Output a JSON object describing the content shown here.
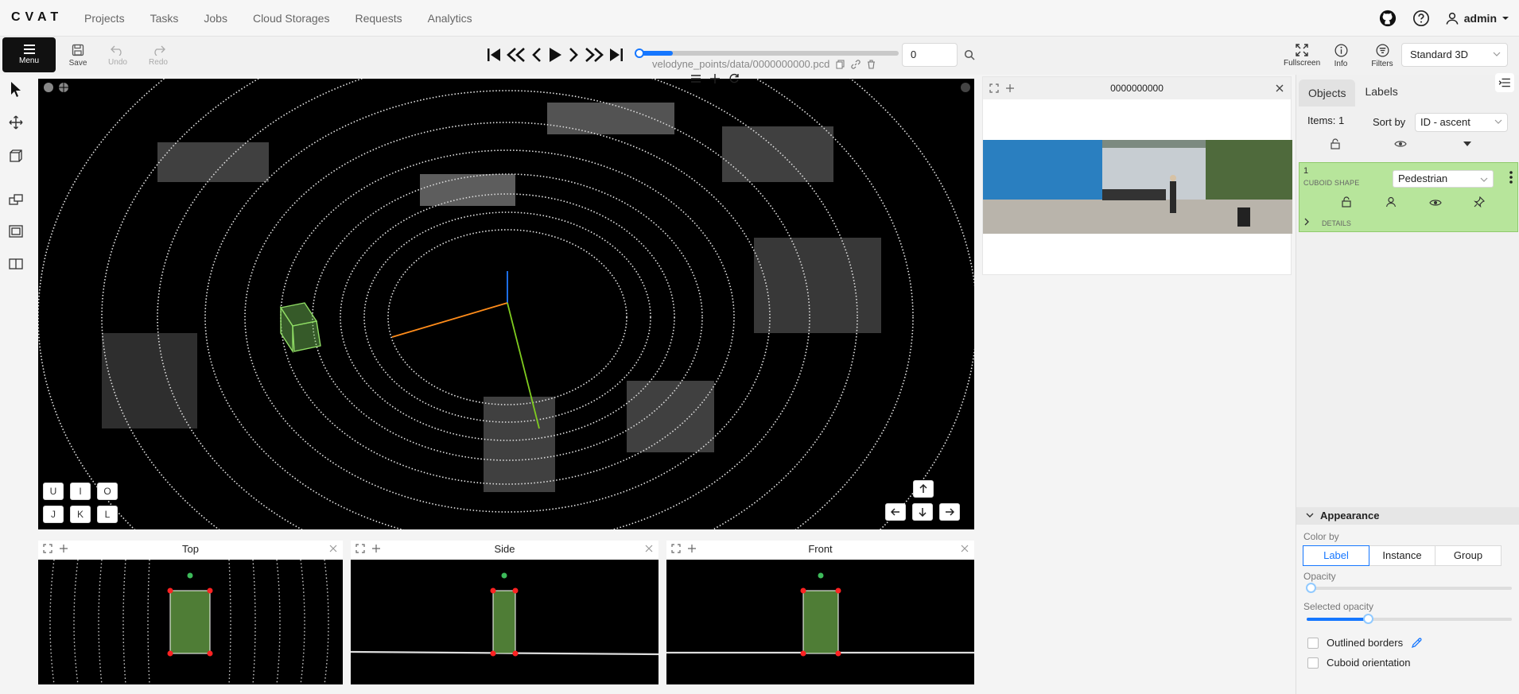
{
  "app": {
    "logo": "CVAT"
  },
  "nav": {
    "items": [
      "Projects",
      "Tasks",
      "Jobs",
      "Cloud Storages",
      "Requests",
      "Analytics"
    ]
  },
  "user": {
    "name": "admin"
  },
  "toolbar": {
    "menu_label": "Menu",
    "save_label": "Save",
    "undo_label": "Undo",
    "redo_label": "Redo",
    "frame_value": "0",
    "filename": "velodyne_points/data/0000000000.pcd",
    "progress": 0.14,
    "fullscreen_label": "Fullscreen",
    "info_label": "Info",
    "filters_label": "Filters",
    "workspace": "Standard 3D"
  },
  "views": {
    "top": "Top",
    "side": "Side",
    "front": "Front",
    "keys_row1": [
      "U",
      "I",
      "O"
    ],
    "keys_row2": [
      "J",
      "K",
      "L"
    ]
  },
  "image_panel": {
    "title": "0000000000"
  },
  "sidebar": {
    "tabs": [
      "Objects",
      "Labels"
    ],
    "items_count": "Items: 1",
    "sort_label": "Sort by",
    "sort_value": "ID - ascent",
    "object": {
      "id": "1",
      "shape": "CUBOID SHAPE",
      "label": "Pedestrian",
      "details": "DETAILS",
      "color": "#b7e59b"
    },
    "appearance": {
      "title": "Appearance",
      "color_by_label": "Color by",
      "color_by_options": [
        "Label",
        "Instance",
        "Group"
      ],
      "color_by_selected": "Label",
      "opacity_label": "Opacity",
      "opacity": 0.02,
      "selected_opacity_label": "Selected opacity",
      "selected_opacity": 0.3,
      "outlined_borders": "Outlined borders",
      "cuboid_orientation": "Cuboid orientation"
    }
  }
}
